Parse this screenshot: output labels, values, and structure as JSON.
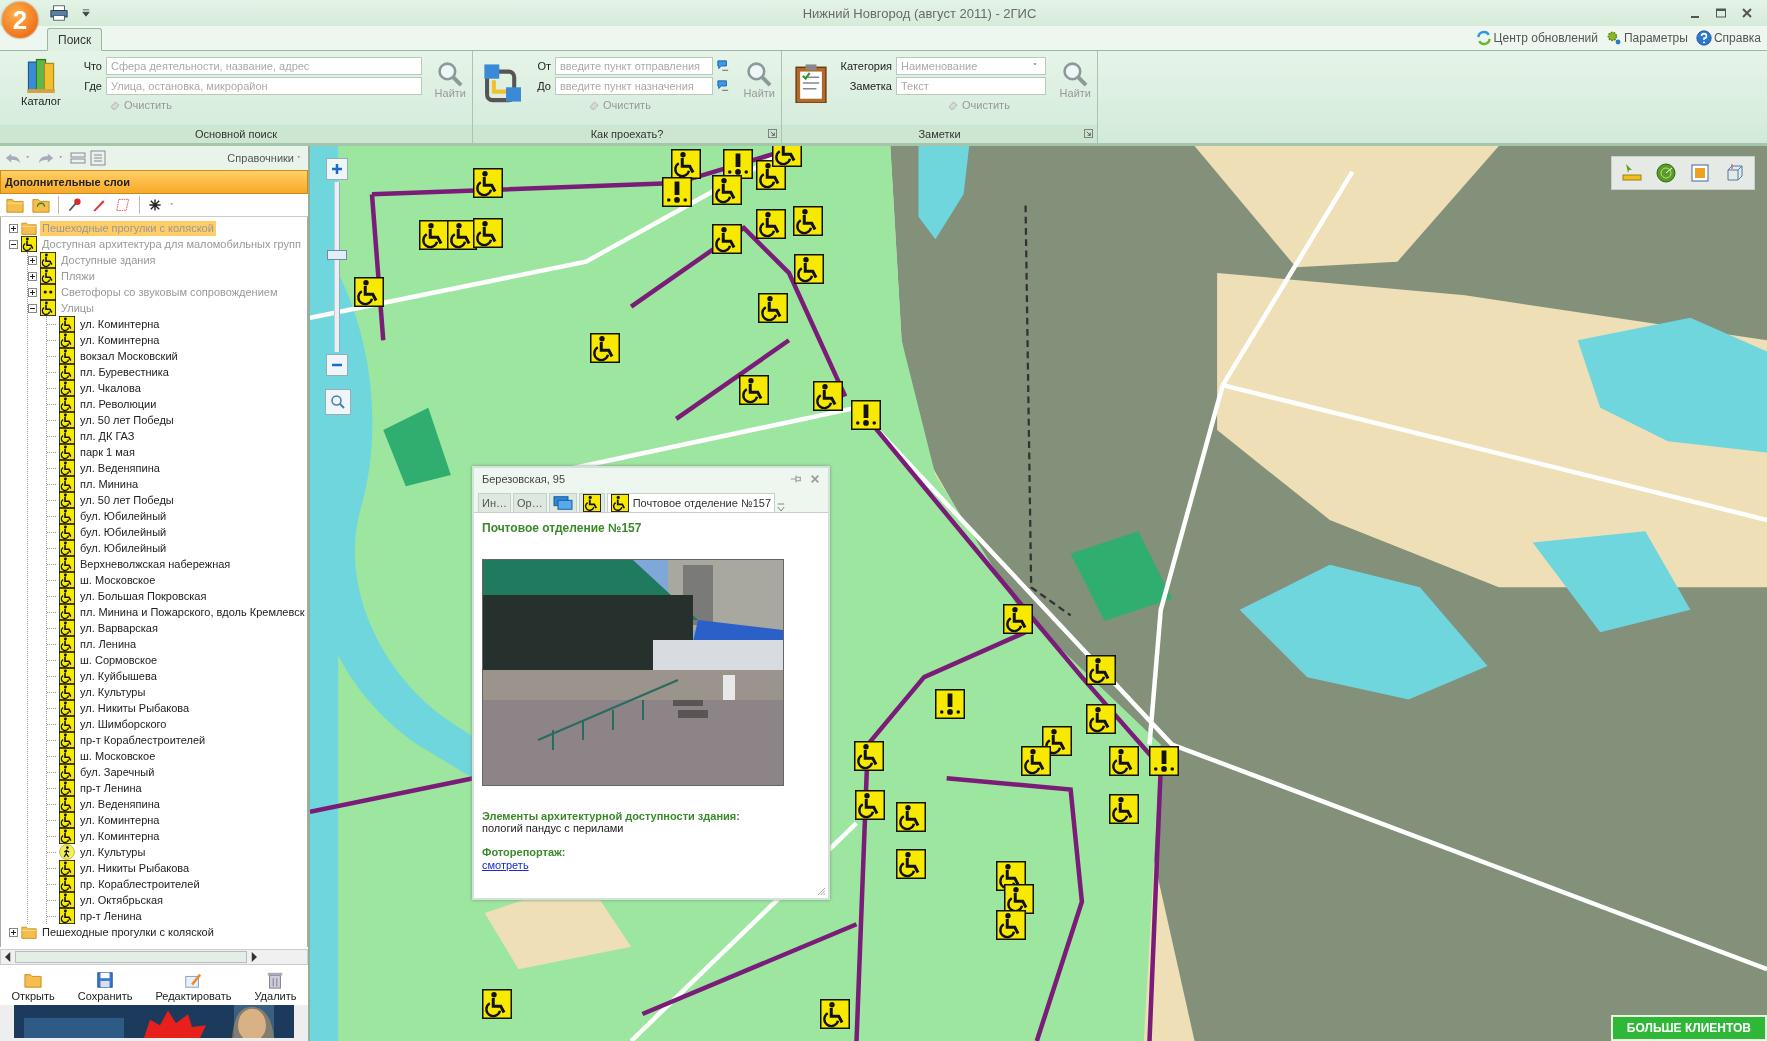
{
  "window": {
    "logo": "2",
    "title": "Нижний Новгород (август 2011) -  2ГИС"
  },
  "tabs": [
    {
      "label": "Поиск",
      "selected": true
    }
  ],
  "header_links": [
    {
      "label": "Центр обновлений",
      "kind": "refresh"
    },
    {
      "label": "Параметры",
      "kind": "gear"
    },
    {
      "label": "Справка",
      "kind": "help"
    }
  ],
  "ribbon_groups": [
    {
      "kind": "search",
      "button": "Каталог",
      "fields": [
        {
          "label": "Что",
          "placeholder": "Сфера деятельности, название, адрес"
        },
        {
          "label": "Где",
          "placeholder": "Улица, остановка, микрорайон"
        }
      ],
      "clear": "Очистить",
      "find": "Найти",
      "caption": "Основной поиск"
    },
    {
      "kind": "route",
      "fields": [
        {
          "label": "От",
          "placeholder": "введите пункт отправления"
        },
        {
          "label": "До",
          "placeholder": "введите пункт назначения"
        }
      ],
      "clear": "Очистить",
      "find": "Найти",
      "caption": "Как проехать?"
    },
    {
      "kind": "notes",
      "fields": [
        {
          "label": "Категория",
          "placeholder": "Наименование",
          "kind": "dropdown"
        },
        {
          "label": "Заметка",
          "placeholder": "Текст",
          "kind": "text"
        }
      ],
      "clear": "Очистить",
      "find": "Найти",
      "caption": "Заметки"
    }
  ],
  "left_panel": {
    "menu": "Справочники",
    "header": "Дополнительные слои",
    "tree": [
      {
        "label": "Пешеходные прогулки с коляской",
        "kind": "folder",
        "selected": true,
        "dimmed": true,
        "expanded": false
      },
      {
        "label": "Доступная архитектура для маломобильных групп",
        "kind": "wheelchair",
        "selected": false,
        "dimmed": true,
        "expanded": true,
        "children": [
          {
            "label": "Доступные здания",
            "kind": "wheelchair",
            "selected": false,
            "dimmed": true,
            "expanded": false
          },
          {
            "label": "Пляжи",
            "kind": "wheelchair",
            "selected": false,
            "dimmed": true,
            "expanded": false
          },
          {
            "label": "Светофоры со звуковым сопровождением",
            "kind": "dots",
            "selected": false,
            "dimmed": true,
            "expanded": false
          },
          {
            "label": "Улицы",
            "kind": "wheelchair",
            "selected": false,
            "dimmed": true,
            "expanded": true,
            "children": [
              {
                "label": "ул. Коминтерна",
                "kind": "wheelchair",
                "selected": false,
                "dimmed": false
              },
              {
                "label": "ул. Коминтерна",
                "kind": "wheelchair",
                "selected": false,
                "dimmed": false
              },
              {
                "label": "вокзал Московский",
                "kind": "wheelchair",
                "selected": false,
                "dimmed": false
              },
              {
                "label": "пл. Буревестника",
                "kind": "wheelchair",
                "selected": false,
                "dimmed": false
              },
              {
                "label": "ул. Чкалова",
                "kind": "wheelchair",
                "selected": false,
                "dimmed": false
              },
              {
                "label": "пл. Революции",
                "kind": "wheelchair",
                "selected": false,
                "dimmed": false
              },
              {
                "label": "ул. 50 лет Победы",
                "kind": "wheelchair",
                "selected": false,
                "dimmed": false
              },
              {
                "label": "пл. ДК ГАЗ",
                "kind": "wheelchair",
                "selected": false,
                "dimmed": false
              },
              {
                "label": "парк 1 мая",
                "kind": "wheelchair",
                "selected": false,
                "dimmed": false
              },
              {
                "label": "ул. Веденяпина",
                "kind": "wheelchair",
                "selected": false,
                "dimmed": false
              },
              {
                "label": "пл. Минина",
                "kind": "wheelchair",
                "selected": false,
                "dimmed": false
              },
              {
                "label": "ул. 50 лет Победы",
                "kind": "wheelchair",
                "selected": false,
                "dimmed": false
              },
              {
                "label": "бул. Юбилейный",
                "kind": "wheelchair",
                "selected": false,
                "dimmed": false
              },
              {
                "label": "бул. Юбилейный",
                "kind": "wheelchair",
                "selected": false,
                "dimmed": false
              },
              {
                "label": "бул. Юбилейный",
                "kind": "wheelchair",
                "selected": false,
                "dimmed": false
              },
              {
                "label": "Верхневолжская набережная",
                "kind": "wheelchair",
                "selected": false,
                "dimmed": false
              },
              {
                "label": "ш. Московское",
                "kind": "wheelchair",
                "selected": false,
                "dimmed": false
              },
              {
                "label": "ул. Большая Покровская",
                "kind": "wheelchair",
                "selected": false,
                "dimmed": false
              },
              {
                "label": "пл. Минина и Пожарского, вдоль Кремлевск",
                "kind": "wheelchair",
                "selected": false,
                "dimmed": false
              },
              {
                "label": "ул. Варварская",
                "kind": "wheelchair",
                "selected": false,
                "dimmed": false
              },
              {
                "label": "пл. Ленина",
                "kind": "wheelchair",
                "selected": false,
                "dimmed": false
              },
              {
                "label": "ш. Сормовское",
                "kind": "wheelchair",
                "selected": false,
                "dimmed": false
              },
              {
                "label": "ул. Куйбышева",
                "kind": "wheelchair",
                "selected": false,
                "dimmed": false
              },
              {
                "label": "ул. Культуры",
                "kind": "wheelchair",
                "selected": false,
                "dimmed": false
              },
              {
                "label": "ул. Никиты Рыбакова",
                "kind": "wheelchair",
                "selected": false,
                "dimmed": false
              },
              {
                "label": "ул. Шимборского",
                "kind": "wheelchair",
                "selected": false,
                "dimmed": false
              },
              {
                "label": "пр-т Кораблестроителей",
                "kind": "wheelchair",
                "selected": false,
                "dimmed": false
              },
              {
                "label": "ш. Московское",
                "kind": "wheelchair",
                "selected": false,
                "dimmed": false
              },
              {
                "label": "бул. Заречный",
                "kind": "wheelchair",
                "selected": false,
                "dimmed": false
              },
              {
                "label": "пр-т Ленина",
                "kind": "wheelchair",
                "selected": false,
                "dimmed": false
              },
              {
                "label": "ул. Веденяпина",
                "kind": "wheelchair",
                "selected": false,
                "dimmed": false
              },
              {
                "label": "ул. Коминтерна",
                "kind": "wheelchair",
                "selected": false,
                "dimmed": false
              },
              {
                "label": "ул. Коминтерна",
                "kind": "wheelchair",
                "selected": false,
                "dimmed": false
              },
              {
                "label": "ул. Культуры",
                "kind": "pedestrian",
                "selected": false,
                "dimmed": false
              },
              {
                "label": "ул. Никиты Рыбакова",
                "kind": "wheelchair",
                "selected": false,
                "dimmed": false
              },
              {
                "label": "пр. Кораблестроителей",
                "kind": "wheelchair",
                "selected": false,
                "dimmed": false
              },
              {
                "label": "ул. Октябрьская",
                "kind": "wheelchair",
                "selected": false,
                "dimmed": false
              },
              {
                "label": "пр-т Ленина",
                "kind": "wheelchair",
                "selected": false,
                "dimmed": false
              }
            ]
          }
        ]
      },
      {
        "label": "Пешеходные прогулки с коляской",
        "kind": "folder",
        "selected": false,
        "dimmed": false,
        "expanded": false
      }
    ],
    "actions": [
      {
        "label": "Открыть",
        "kind": "open"
      },
      {
        "label": "Сохранить",
        "kind": "save"
      },
      {
        "label": "Редактировать",
        "kind": "edit"
      },
      {
        "label": "Удалить",
        "kind": "delete"
      }
    ]
  },
  "map": {
    "zoom_slider": {
      "level": 0.55
    },
    "ad_banner": "БОЛЬШЕ КЛИЕНТОВ"
  },
  "popup": {
    "title": "Березовская, 95",
    "tabs": [
      {
        "label": "Ин…",
        "kind": "text",
        "selected": false
      },
      {
        "label": "Ор…",
        "kind": "text",
        "selected": false
      },
      {
        "kind": "monitor",
        "selected": false
      },
      {
        "kind": "wheelchair",
        "selected": false
      },
      {
        "kind": "wheelchair",
        "label": "Почтовое отделение №157",
        "selected": true
      }
    ],
    "heading": "Почтовое отделение №157",
    "sections": [
      {
        "label": "Элементы архитектурной доступности здания:",
        "text": "пологий пандус с перилами"
      },
      {
        "label": "Фоторепортаж:",
        "link": "смотреть"
      }
    ]
  }
}
